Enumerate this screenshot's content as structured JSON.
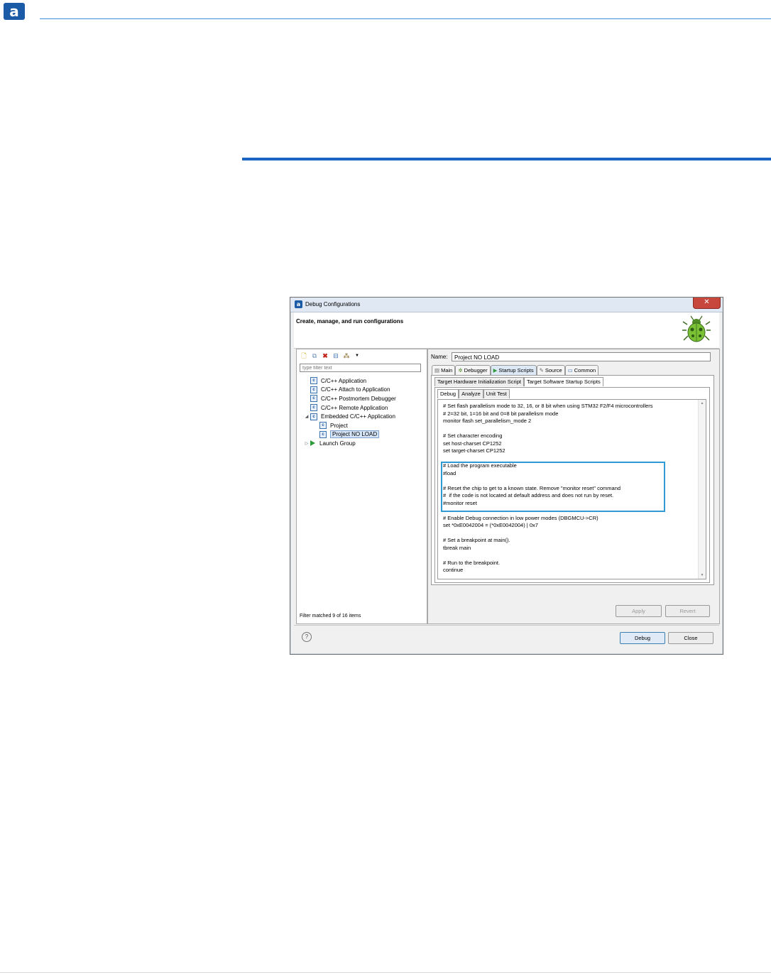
{
  "page": {
    "logo_letter": "a"
  },
  "window": {
    "title": "Debug Configurations",
    "close_glyph": "✕",
    "header_title": "Create, manage, and run configurations",
    "left": {
      "filter_placeholder": "type filter text",
      "tree": [
        {
          "label": "C/C++ Application",
          "icon": "c-config-icon",
          "level": 1
        },
        {
          "label": "C/C++ Attach to Application",
          "icon": "c-config-icon",
          "level": 1
        },
        {
          "label": "C/C++ Postmortem Debugger",
          "icon": "c-config-icon",
          "level": 1
        },
        {
          "label": "C/C++ Remote Application",
          "icon": "c-config-icon",
          "level": 1
        },
        {
          "label": "Embedded C/C++ Application",
          "icon": "c-config-icon",
          "level": 1,
          "expanded": true
        },
        {
          "label": "Project",
          "icon": "c-config-icon",
          "level": 2
        },
        {
          "label": "Project NO LOAD",
          "icon": "c-config-icon",
          "level": 2,
          "selected": true
        },
        {
          "label": "Launch Group",
          "icon": "launch-group-icon",
          "level": 1,
          "collapsed": true
        }
      ],
      "filter_status": "Filter matched 9 of 16 items"
    },
    "right": {
      "name_label": "Name:",
      "name_value": "Project NO LOAD",
      "tabs": [
        "Main",
        "Debugger",
        "Startup Scripts",
        "Source",
        "Common"
      ],
      "active_tab": "Startup Scripts",
      "subtabs": [
        "Target Hardware Initialization Script",
        "Target Software Startup Scripts"
      ],
      "active_subtab": "Target Software Startup Scripts",
      "subsubtabs": [
        "Debug",
        "Analyze",
        "Unit Test"
      ],
      "active_subsubtab": "Debug",
      "script_lines": [
        "# Set flash parallelism mode to 32, 16, or 8 bit when using STM32 F2/F4 microcontrollers",
        "# 2=32 bit, 1=16 bit and 0=8 bit parallelism mode",
        "monitor flash set_parallelism_mode 2",
        "",
        "# Set character encoding",
        "set host-charset CP1252",
        "set target-charset CP1252",
        "",
        "# Load the program executable",
        "#load",
        "",
        "# Reset the chip to get to a known state. Remove \"monitor reset\" command",
        "#  if the code is not located at default address and does not run by reset.",
        "#monitor reset",
        "",
        "# Enable Debug connection in low power modes (DBGMCU->CR)",
        "set *0xE0042004 = (*0xE0042004) | 0x7",
        "",
        "# Set a breakpoint at main().",
        "tbreak main",
        "",
        "# Run to the breakpoint.",
        "continue"
      ],
      "apply_label": "Apply",
      "revert_label": "Revert"
    },
    "debug_label": "Debug",
    "close_label": "Close",
    "help_glyph": "?"
  },
  "colors": {
    "accent_blue": "#1a66c2",
    "highlight_box": "#2e9ad6"
  }
}
